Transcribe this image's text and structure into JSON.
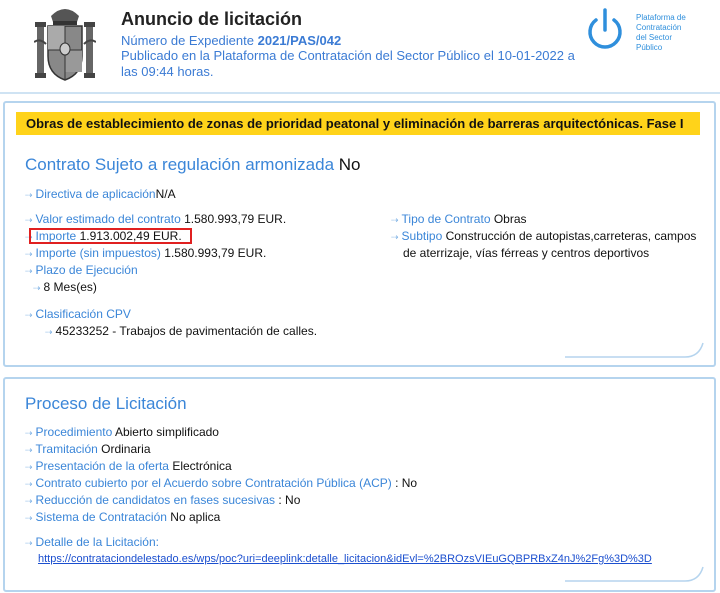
{
  "header": {
    "title": "Anuncio de licitación",
    "expediente_label": "Número de Expediente",
    "expediente_value": "2021/PAS/042",
    "published_line1": "Publicado en la Plataforma de Contratación del Sector Público el 10-01-2022 a",
    "published_line2": "las 09:44 horas.",
    "platform_logo_text": [
      "Plataforma de",
      "Contratación",
      "del Sector",
      "Público"
    ]
  },
  "contract": {
    "banner": "Obras de establecimiento de zonas de prioridad peatonal y eliminación de barreras arquitectónicas. Fase I",
    "title_label": "Contrato Sujeto a regulación armonizada",
    "title_value": "No",
    "directiva_label": "Directiva de aplicación",
    "directiva_value": "N/A",
    "valor_label": "Valor estimado del contrato",
    "valor_value": "1.580.993,79 EUR.",
    "importe_label": "Importe",
    "importe_value": "1.913.002,49 EUR.",
    "importe_sin_label": "Importe (sin impuestos)",
    "importe_sin_value": "1.580.993,79 EUR.",
    "plazo_label": "Plazo de Ejecución",
    "plazo_value": "8 Mes(es)",
    "cpv_label": "Clasificación CPV",
    "cpv_value": "45233252 - Trabajos de pavimentación de calles.",
    "tipo_label": "Tipo de Contrato",
    "tipo_value": "Obras",
    "subtipo_label": "Subtipo",
    "subtipo_value_line1": "Construcción de autopistas,carreteras, campos",
    "subtipo_value_line2": "de aterrizaje, vías férreas y centros deportivos"
  },
  "proceso": {
    "title": "Proceso de Licitación",
    "procedimiento_label": "Procedimiento",
    "procedimiento_value": "Abierto simplificado",
    "tramitacion_label": "Tramitación",
    "tramitacion_value": "Ordinaria",
    "presentacion_label": "Presentación de la oferta",
    "presentacion_value": "Electrónica",
    "acp_label": "Contrato cubierto por el Acuerdo sobre Contratación Pública (ACP)",
    "acp_value": ": No",
    "reduccion_label": "Reducción de candidatos en fases sucesivas",
    "reduccion_value": ": No",
    "sistema_label": "Sistema de Contratación",
    "sistema_value": "No aplica",
    "detalle_label": "Detalle de la Licitación:",
    "detalle_url": "https://contrataciondelestado.es/wps/poc?uri=deeplink:detalle_licitacion&idEvl=%2BROzsVIEuGQBPRBxZ4nJ%2Fg%3D%3D"
  },
  "colors": {
    "accent_blue": "#3b86d8",
    "banner_yellow": "#ffd31a",
    "highlight_red": "#e02020",
    "link_blue": "#1b4fcf"
  },
  "icons": [
    "spain-coat-of-arms",
    "platform-power-icon",
    "arrow-bullet-icon"
  ]
}
